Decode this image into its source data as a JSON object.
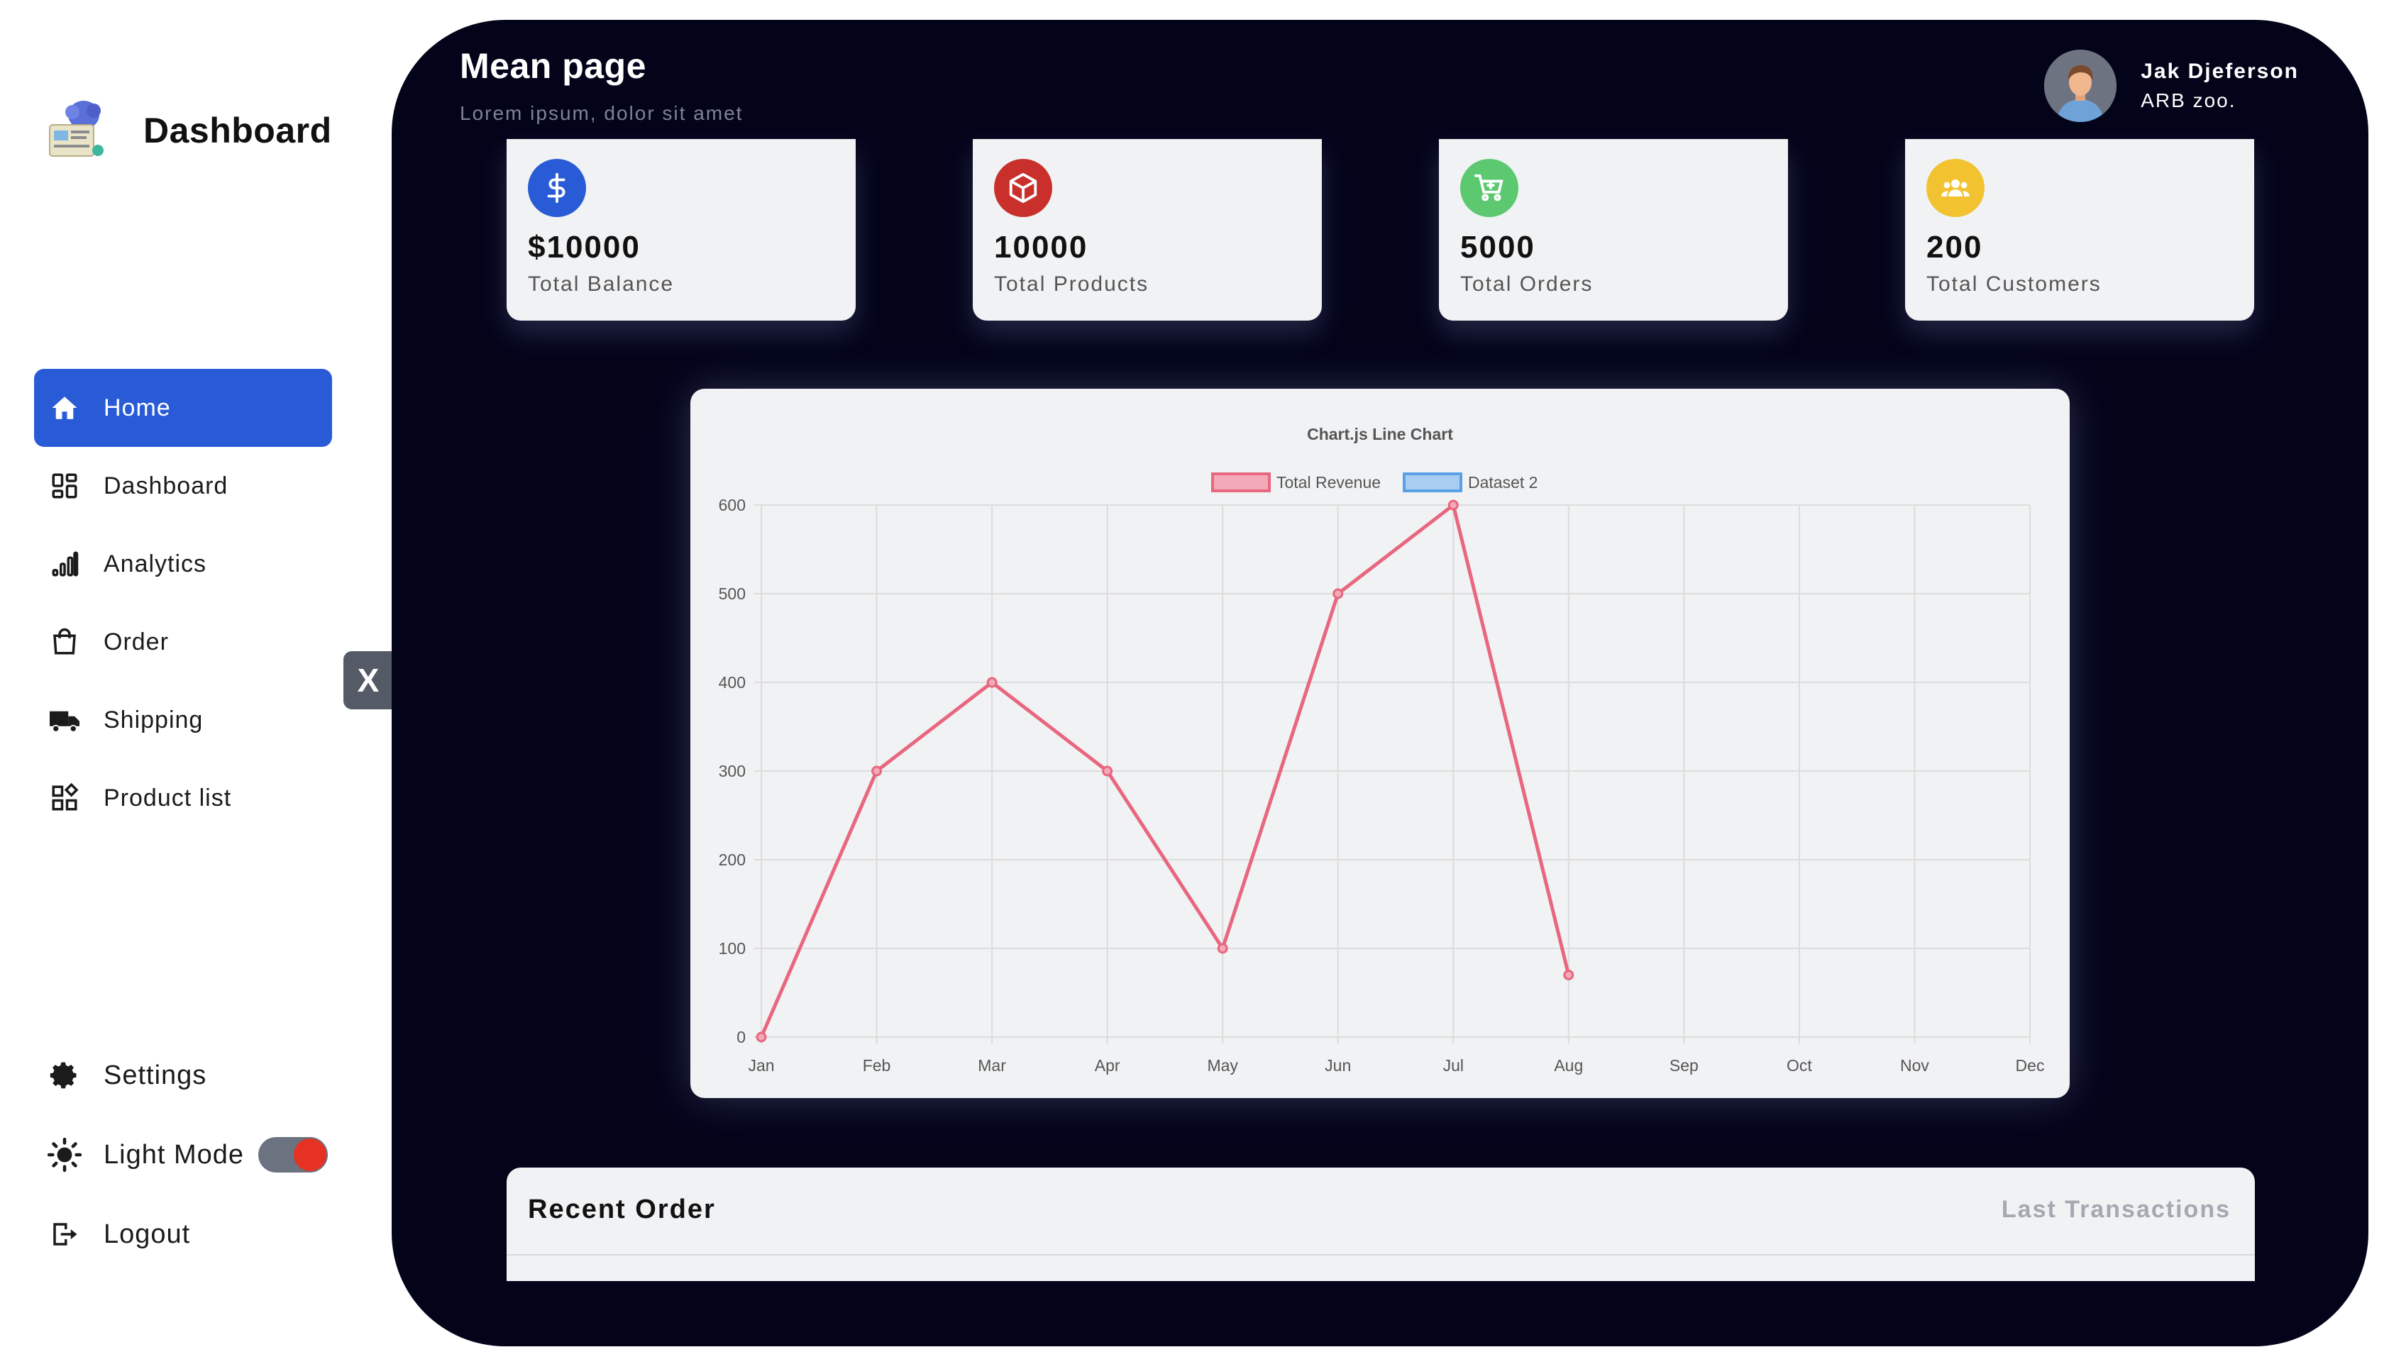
{
  "sidebar": {
    "brand": "Dashboard",
    "items": [
      {
        "label": "Home",
        "icon": "home-icon"
      },
      {
        "label": "Dashboard",
        "icon": "grid-icon"
      },
      {
        "label": "Analytics",
        "icon": "bar-chart-icon"
      },
      {
        "label": "Order",
        "icon": "shopping-bag-icon"
      },
      {
        "label": "Shipping",
        "icon": "truck-icon"
      },
      {
        "label": "Product list",
        "icon": "product-list-icon"
      }
    ],
    "bottom": {
      "settings": "Settings",
      "light_mode": "Light Mode",
      "logout": "Logout"
    },
    "close_label": "X",
    "colors": {
      "active": "#2a5bd7",
      "toggle_knob": "#e53222"
    }
  },
  "header": {
    "title": "Mean page",
    "subtitle": "Lorem ipsum, dolor sit amet",
    "user_name": "Jak Djeferson",
    "user_org": "ARB zoo."
  },
  "cards": [
    {
      "value": "$10000",
      "label": "Total Balance",
      "icon": "dollar-icon",
      "color": "#2a5bd7"
    },
    {
      "value": "10000",
      "label": "Total Products",
      "icon": "box-icon",
      "color": "#c9302c"
    },
    {
      "value": "5000",
      "label": "Total Orders",
      "icon": "cart-icon",
      "color": "#5cc970"
    },
    {
      "value": "200",
      "label": "Total Customers",
      "icon": "users-icon",
      "color": "#f2c230"
    }
  ],
  "chart_data": {
    "type": "line",
    "title": "Chart.js Line Chart",
    "categories": [
      "Jan",
      "Feb",
      "Mar",
      "Apr",
      "May",
      "Jun",
      "Jul",
      "Aug",
      "Sep",
      "Oct",
      "Nov",
      "Dec"
    ],
    "series": [
      {
        "name": "Total Revenue",
        "values": [
          0,
          300,
          400,
          300,
          100,
          500,
          600,
          70
        ],
        "color": "#e8677f"
      },
      {
        "name": "Dataset 2",
        "values": [],
        "color": "#5aa0e6"
      }
    ],
    "yticks": [
      0,
      100,
      200,
      300,
      400,
      500,
      600
    ],
    "ylim": [
      0,
      600
    ],
    "grid": true,
    "legend": "top"
  },
  "recent": {
    "title": "Recent Order",
    "link": "Last Transactions"
  }
}
